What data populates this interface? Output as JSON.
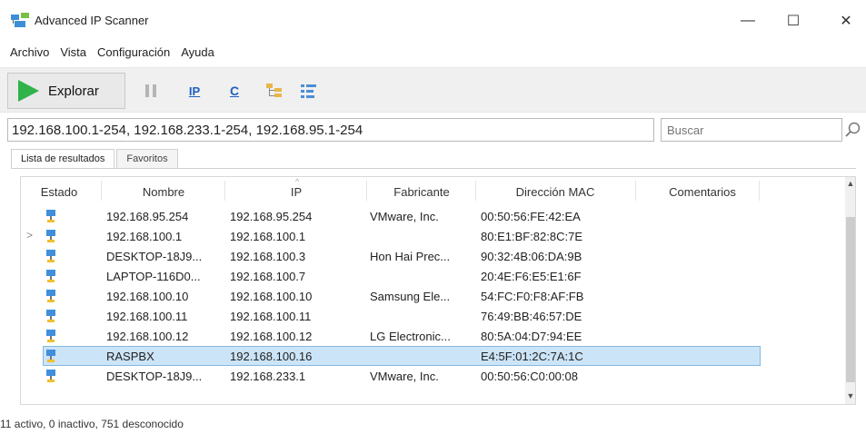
{
  "window": {
    "title": "Advanced IP Scanner",
    "controls": {
      "minimize": "—",
      "maximize": "☐",
      "close": "✕"
    }
  },
  "menu": {
    "items": [
      "Archivo",
      "Vista",
      "Configuración",
      "Ayuda"
    ]
  },
  "toolbar": {
    "scan_label": "Explorar",
    "icons": [
      "pause-icon",
      "ip-icon",
      "c-icon",
      "expand-all-icon",
      "collapse-all-icon"
    ],
    "ip_glyph": "IP",
    "c_glyph": "C"
  },
  "inputs": {
    "range_value": "192.168.100.1-254, 192.168.233.1-254, 192.168.95.1-254",
    "search_placeholder": "Buscar"
  },
  "tabs": [
    {
      "label": "Lista de resultados",
      "active": true
    },
    {
      "label": "Favoritos",
      "active": false
    }
  ],
  "table": {
    "columns": [
      "Estado",
      "Nombre",
      "IP",
      "Fabricante",
      "Dirección MAC",
      "Comentarios"
    ],
    "rows": [
      {
        "name": "192.168.95.254",
        "ip": "192.168.95.254",
        "vendor": "VMware, Inc.",
        "mac": "00:50:56:FE:42:EA",
        "comment": "",
        "expandable": false,
        "selected": false
      },
      {
        "name": "192.168.100.1",
        "ip": "192.168.100.1",
        "vendor": "",
        "mac": "80:E1:BF:82:8C:7E",
        "comment": "",
        "expandable": true,
        "selected": false
      },
      {
        "name": "DESKTOP-18J9...",
        "ip": "192.168.100.3",
        "vendor": "Hon Hai Prec...",
        "mac": "90:32:4B:06:DA:9B",
        "comment": "",
        "expandable": false,
        "selected": false
      },
      {
        "name": "LAPTOP-116D0...",
        "ip": "192.168.100.7",
        "vendor": "",
        "mac": "20:4E:F6:E5:E1:6F",
        "comment": "",
        "expandable": false,
        "selected": false
      },
      {
        "name": "192.168.100.10",
        "ip": "192.168.100.10",
        "vendor": "Samsung Ele...",
        "mac": "54:FC:F0:F8:AF:FB",
        "comment": "",
        "expandable": false,
        "selected": false
      },
      {
        "name": "192.168.100.11",
        "ip": "192.168.100.11",
        "vendor": "",
        "mac": "76:49:BB:46:57:DE",
        "comment": "",
        "expandable": false,
        "selected": false
      },
      {
        "name": "192.168.100.12",
        "ip": "192.168.100.12",
        "vendor": "LG Electronic...",
        "mac": "80:5A:04:D7:94:EE",
        "comment": "",
        "expandable": false,
        "selected": false
      },
      {
        "name": "RASPBX",
        "ip": "192.168.100.16",
        "vendor": "",
        "mac": "E4:5F:01:2C:7A:1C",
        "comment": "",
        "expandable": false,
        "selected": true
      },
      {
        "name": "DESKTOP-18J9...",
        "ip": "192.168.233.1",
        "vendor": "VMware, Inc.",
        "mac": "00:50:56:C0:00:08",
        "comment": "",
        "expandable": false,
        "selected": false
      }
    ]
  },
  "status": {
    "summary": "11 activo, 0 inactivo, 751 desconocido"
  },
  "colors": {
    "selection_bg": "#cce4f7",
    "selection_border": "#84b8e0",
    "play_green": "#2fb34a",
    "ip_blue": "#1f5fbf"
  }
}
